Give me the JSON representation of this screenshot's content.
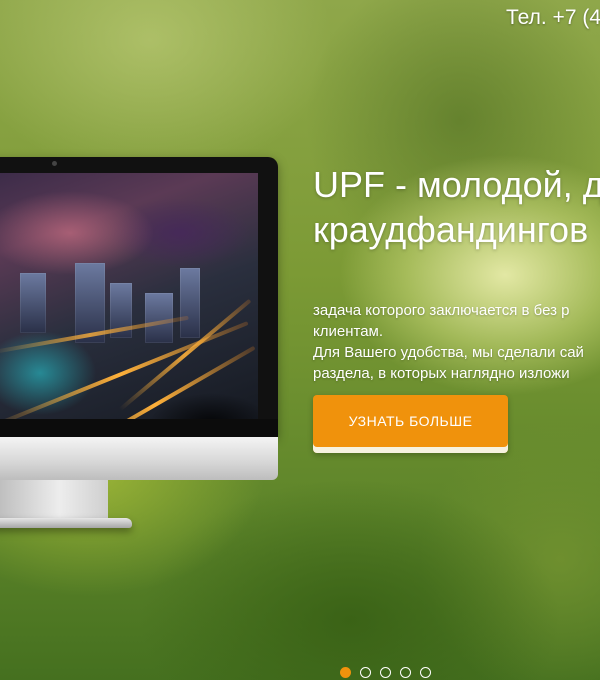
{
  "header": {
    "phone": "Тел. +7 (4"
  },
  "hero": {
    "title_line1": "UPF - молодой, д",
    "title_line2": "краудфандингов",
    "description_line1": "задача которого заключается в без р",
    "description_line2": "клиентам.",
    "description_line3": "Для Вашего удобства, мы сделали сай",
    "description_line4": "раздела, в которых наглядно изложи",
    "cta_label": "УЗНАТЬ БОЛЬШЕ"
  },
  "slider": {
    "dot_count": 5,
    "active_index": 0
  },
  "colors": {
    "accent": "#f0920c",
    "text": "#ffffff"
  },
  "icons": [
    "monitor-illustration"
  ]
}
